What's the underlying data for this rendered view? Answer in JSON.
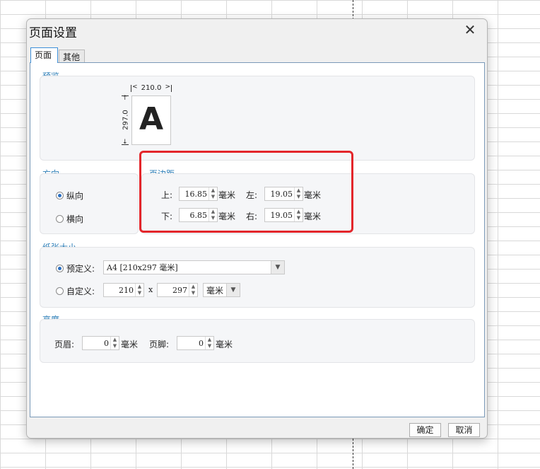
{
  "dialog": {
    "title": "页面设置",
    "close_glyph": "✕"
  },
  "tabs": [
    {
      "label": "页面",
      "selected": true
    },
    {
      "label": "其他",
      "selected": false
    }
  ],
  "preview": {
    "title": "预览",
    "width_label": "210.0",
    "height_label": "297.0",
    "glyph": "A"
  },
  "orientation": {
    "title": "方向",
    "portrait": "纵向",
    "landscape": "横向",
    "selected": "portrait"
  },
  "margins": {
    "title": "页边距",
    "top_label": "上:",
    "top_value": "16.85",
    "left_label": "左:",
    "left_value": "19.05",
    "bottom_label": "下:",
    "bottom_value": "6.85",
    "right_label": "右:",
    "right_value": "19.05",
    "unit": "毫米"
  },
  "paper_size": {
    "title": "纸张大小",
    "predefined_label": "预定义:",
    "predefined_value": "A4 [210x297 毫米]",
    "custom_label": "自定义:",
    "custom_width": "210",
    "times": "x",
    "custom_height": "297",
    "custom_unit": "毫米",
    "selected": "predefined"
  },
  "height": {
    "title": "高度",
    "header_label": "页眉:",
    "header_value": "0",
    "footer_label": "页脚:",
    "footer_value": "0",
    "unit": "毫米"
  },
  "buttons": {
    "ok": "确定",
    "cancel": "取消"
  },
  "colors": {
    "accent": "#2e7fb8",
    "highlight": "#e3262b"
  }
}
